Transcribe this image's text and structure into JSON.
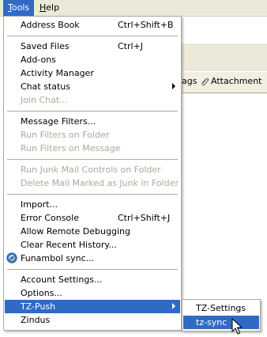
{
  "menubar": {
    "tools": {
      "accel": "T",
      "rest": "ools"
    },
    "help": {
      "accel": "H",
      "rest": "elp"
    }
  },
  "background": {
    "toolbar_fragment_tags": "ags",
    "toolbar_fragment_attachment": "Attachment"
  },
  "tools_menu": {
    "items": [
      {
        "label": "Address Book",
        "shortcut": "Ctrl+Shift+B"
      },
      {
        "label": "Saved Files",
        "shortcut": "Ctrl+J"
      },
      {
        "label": "Add-ons"
      },
      {
        "label": "Activity Manager"
      },
      {
        "label": "Chat status"
      },
      {
        "label": "Join Chat..."
      },
      {
        "label": "Message Filters..."
      },
      {
        "label": "Run Filters on Folder"
      },
      {
        "label": "Run Filters on Message"
      },
      {
        "label": "Run Junk Mail Controls on Folder"
      },
      {
        "label": "Delete Mail Marked as Junk in Folder"
      },
      {
        "label": "Import..."
      },
      {
        "label": "Error Console",
        "shortcut": "Ctrl+Shift+J"
      },
      {
        "label": "Allow Remote Debugging"
      },
      {
        "label": "Clear Recent History..."
      },
      {
        "label": "Funambol sync..."
      },
      {
        "label": "Account Settings..."
      },
      {
        "label": "Options..."
      },
      {
        "label": "TZ-Push"
      },
      {
        "label": "Zindus"
      }
    ]
  },
  "tzpush_submenu": {
    "items": [
      {
        "label": "TZ-Settings"
      },
      {
        "label": "tz-sync"
      }
    ]
  },
  "colors": {
    "highlight": "#316ac5",
    "menubar_bg": "#ece9d8",
    "disabled_text": "#aca899"
  }
}
